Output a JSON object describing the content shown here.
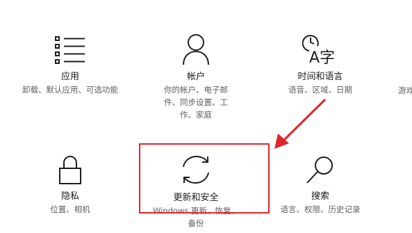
{
  "tiles": {
    "apps": {
      "title": "应用",
      "desc": "卸载、默认应用、可选功能",
      "icon": "apps-list-icon"
    },
    "accounts": {
      "title": "帐户",
      "desc": "你的帐户、电子邮件、同步设置、工作、家庭",
      "icon": "person-icon"
    },
    "time_language": {
      "title": "时间和语言",
      "desc": "语音、区域、日期",
      "icon": "clock-language-icon",
      "icon_glyph": "A字"
    },
    "gaming": {
      "desc_partial": "游戏"
    },
    "privacy": {
      "title": "隐私",
      "desc": "位置、相机",
      "icon": "lock-icon"
    },
    "update_security": {
      "title": "更新和安全",
      "desc": "Windows 更新、恢复、备份",
      "icon": "sync-icon"
    },
    "search": {
      "title": "搜索",
      "desc": "语言、权限、历史记录",
      "icon": "magnifier-icon"
    }
  },
  "annotation": {
    "highlight_color": "#e0252b",
    "arrow_color": "#e0252b"
  }
}
